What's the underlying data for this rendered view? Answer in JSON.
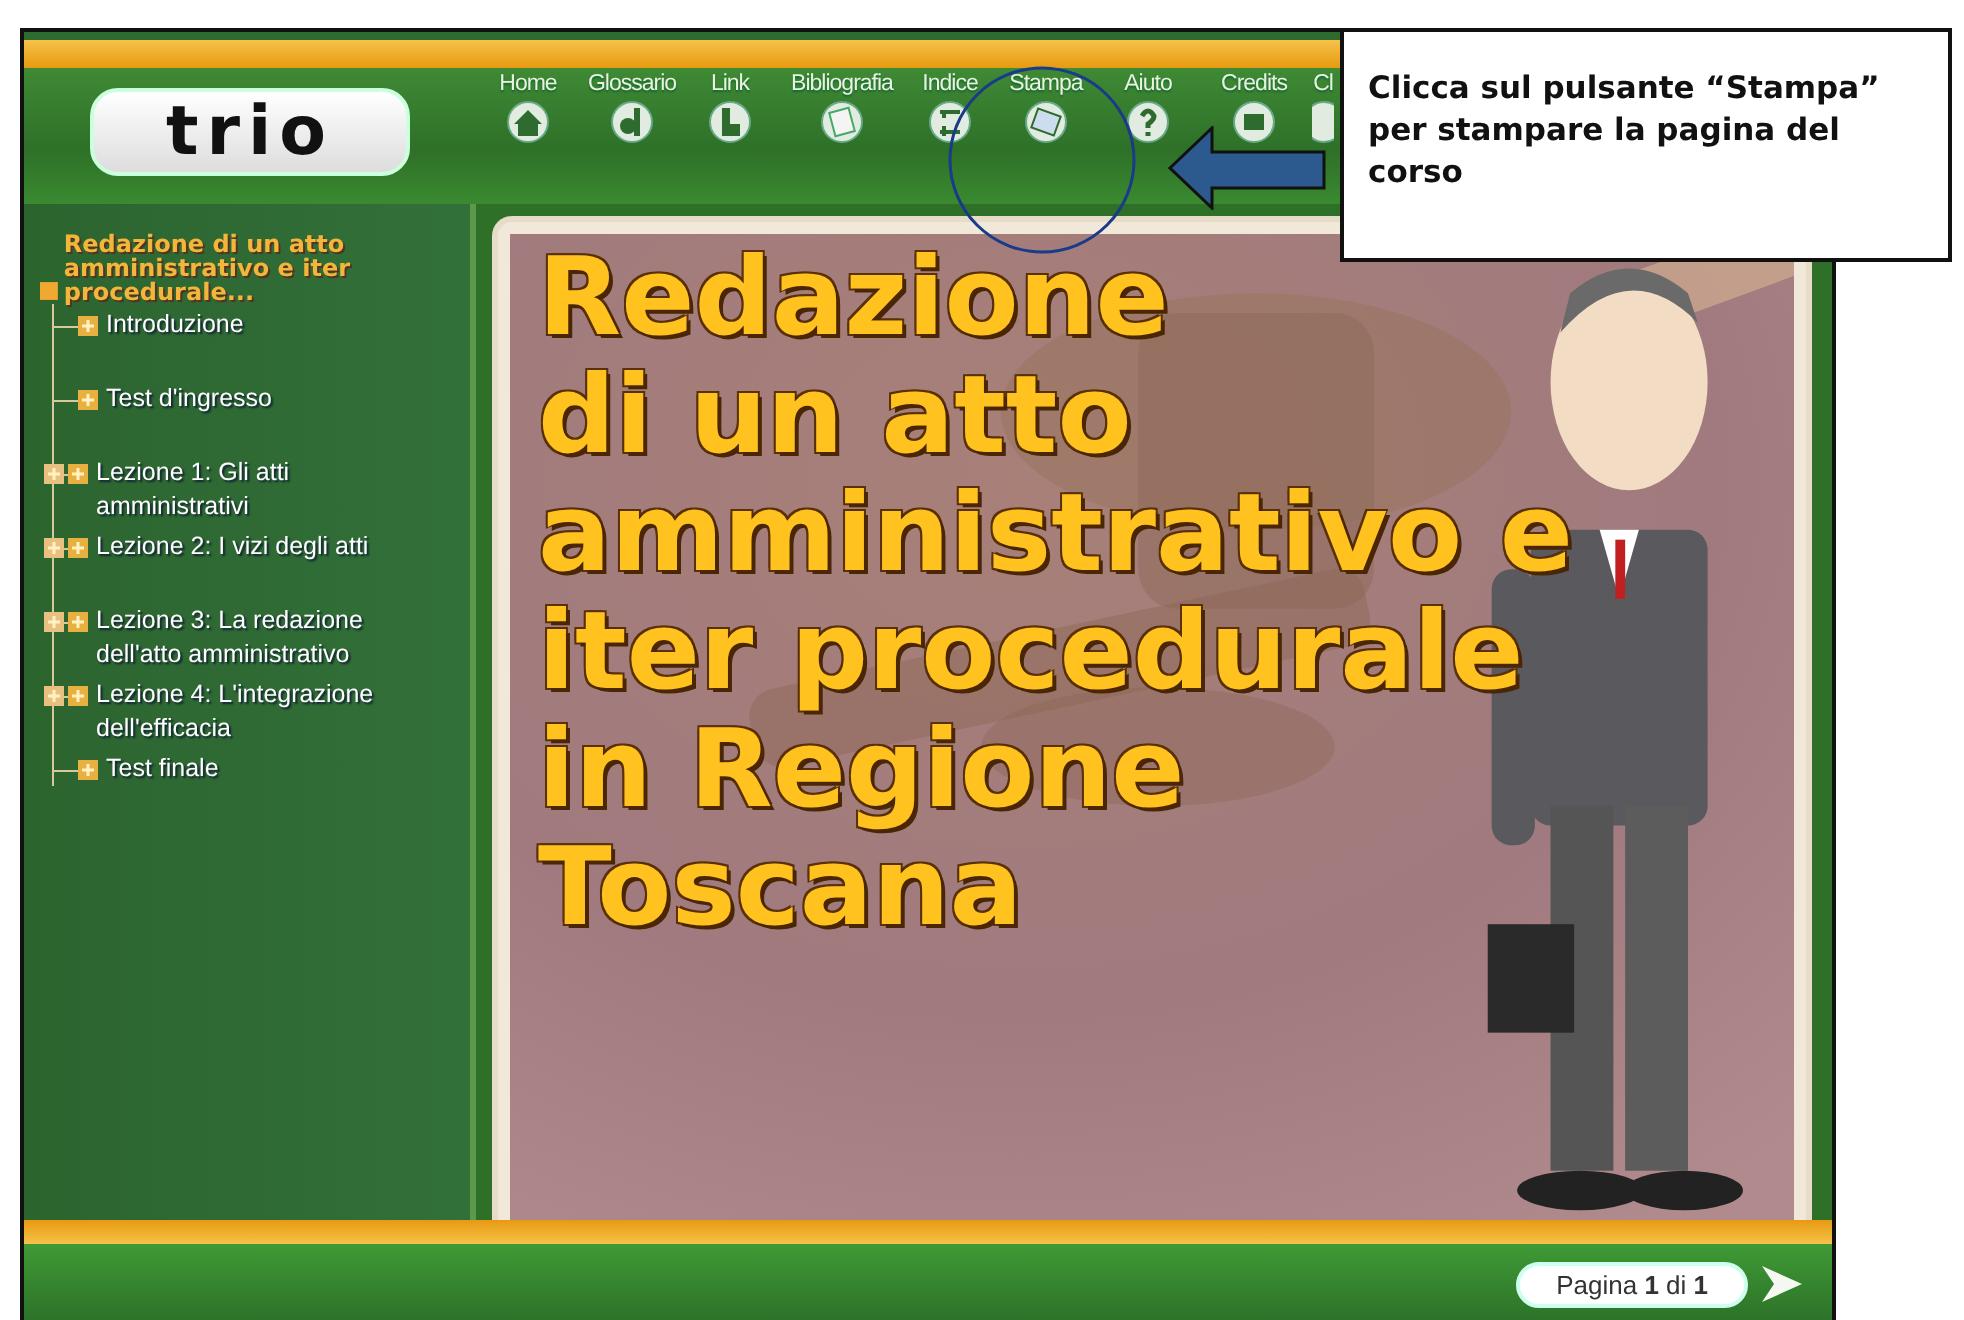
{
  "logo": {
    "text": "trio"
  },
  "nav": [
    {
      "label": "Home"
    },
    {
      "label": "Glossario"
    },
    {
      "label": "Link"
    },
    {
      "label": "Bibliografia"
    },
    {
      "label": "Indice"
    },
    {
      "label": "Stampa"
    },
    {
      "label": "Aiuto"
    },
    {
      "label": "Credits"
    },
    {
      "label": "Cl"
    }
  ],
  "tree": {
    "label": "Redazione di un atto amministrativo e iter procedurale...",
    "children": [
      {
        "label": "Introduzione",
        "kind": "page"
      },
      {
        "label": "Test d'ingresso",
        "kind": "page"
      },
      {
        "label": "Lezione 1: Gli atti amministrativi",
        "kind": "folder"
      },
      {
        "label": "Lezione 2: I vizi degli atti",
        "kind": "folder"
      },
      {
        "label": "Lezione 3: La redazione dell'atto amministrativo",
        "kind": "folder"
      },
      {
        "label": "Lezione 4: L'integrazione dell'efficacia",
        "kind": "folder"
      },
      {
        "label": "Test finale",
        "kind": "page"
      }
    ]
  },
  "slide": {
    "title_lines": [
      "Redazione",
      "di un atto",
      "amministrativo e",
      "iter procedurale",
      "in Regione",
      "Toscana"
    ]
  },
  "footer": {
    "page": "Pagina **1** di **1**"
  },
  "callout": {
    "text": "Clicca sul pulsante “Stampa” per stampare la pagina del corso"
  }
}
